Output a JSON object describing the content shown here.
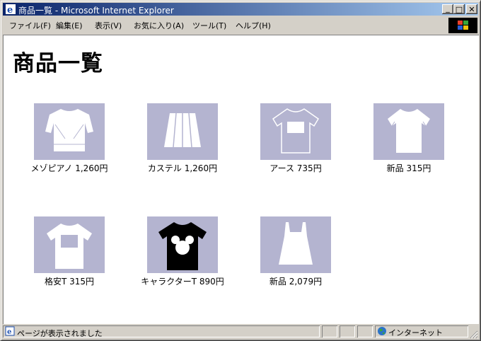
{
  "window": {
    "title": "商品一覧 - Microsoft Internet Explorer",
    "controls": {
      "minimize": "_",
      "maximize": "□",
      "close": "✕"
    }
  },
  "menu": [
    {
      "label": "ファイル(F)"
    },
    {
      "label": "編集(E)"
    },
    {
      "label": "表示(V)"
    },
    {
      "label": "お気に入り(A)"
    },
    {
      "label": "ツール(T)"
    },
    {
      "label": "ヘルプ(H)"
    }
  ],
  "page": {
    "title": "商品一覧",
    "products": [
      {
        "caption": "メゾピアノ 1,260円",
        "icon": "sweater-icon"
      },
      {
        "caption": "カステル 1,260円",
        "icon": "skirt-icon"
      },
      {
        "caption": "アース 735円",
        "icon": "tshirt-print-icon"
      },
      {
        "caption": "新品 315円",
        "icon": "tshirt-icon"
      },
      {
        "caption": "格安T 315円",
        "icon": "tshirt-box-icon"
      },
      {
        "caption": "キャラクターT 890円",
        "icon": "character-tshirt-icon"
      },
      {
        "caption": "新品 2,079円",
        "icon": "tank-dress-icon"
      }
    ]
  },
  "status": {
    "text": "ページが表示されました",
    "zone": "インターネット"
  },
  "colors": {
    "titlebar_start": "#0a246a",
    "titlebar_end": "#a6caf0",
    "thumb_bg": "#b4b4d0"
  }
}
